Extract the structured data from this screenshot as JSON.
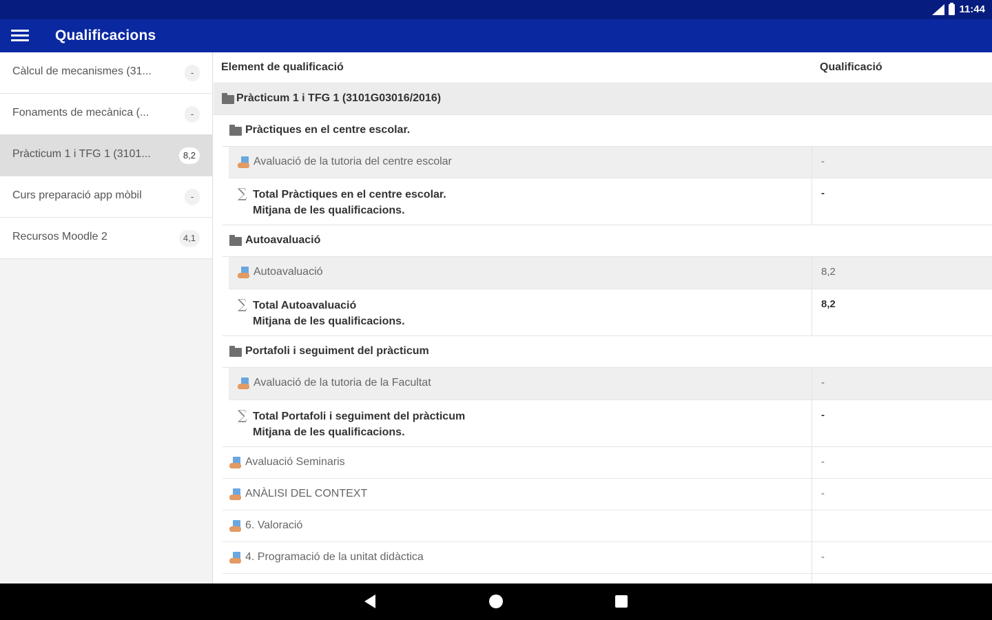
{
  "status_bar": {
    "time": "11:44"
  },
  "app_bar": {
    "title": "Qualificacions"
  },
  "sidebar": {
    "courses": [
      {
        "name": "Càlcul de mecanismes (31...",
        "grade": "-"
      },
      {
        "name": "Fonaments de mecànica (...",
        "grade": "-"
      },
      {
        "name": "Pràcticum 1 i TFG 1 (3101...",
        "grade": "8,2"
      },
      {
        "name": "Curs preparació app mòbil",
        "grade": "-"
      },
      {
        "name": "Recursos Moodle 2",
        "grade": "4,1"
      }
    ]
  },
  "table": {
    "col_element": "Element de qualificació",
    "col_grade": "Qualificació",
    "course_category": "Pràcticum 1 i TFG 1 (3101G03016/2016)",
    "cat1": {
      "name": "Pràctiques en el centre escolar.",
      "item": {
        "name": "Avaluació de la tutoria del centre escolar",
        "grade": "-"
      },
      "total": {
        "line1": "Total Pràctiques en el centre escolar.",
        "line2": "Mitjana de les qualificacions.",
        "grade": "-"
      }
    },
    "cat2": {
      "name": "Autoavaluació",
      "item": {
        "name": "Autoavaluació",
        "grade": "8,2"
      },
      "total": {
        "line1": "Total Autoavaluació",
        "line2": "Mitjana de les qualificacions.",
        "grade": "8,2"
      }
    },
    "cat3": {
      "name": "Portafoli i seguiment del pràcticum",
      "item": {
        "name": "Avaluació de la tutoria de la Facultat",
        "grade": "-"
      },
      "total": {
        "line1": "Total Portafoli i seguiment del pràcticum",
        "line2": "Mitjana de les qualificacions.",
        "grade": "-"
      }
    },
    "items": [
      {
        "name": "Avaluació Seminaris",
        "grade": "-"
      },
      {
        "name": "ANÀLISI DEL CONTEXT",
        "grade": "-"
      },
      {
        "name": "6. Valoració",
        "grade": ""
      },
      {
        "name": "4. Programació de la unitat didàctica",
        "grade": "-"
      }
    ]
  }
}
